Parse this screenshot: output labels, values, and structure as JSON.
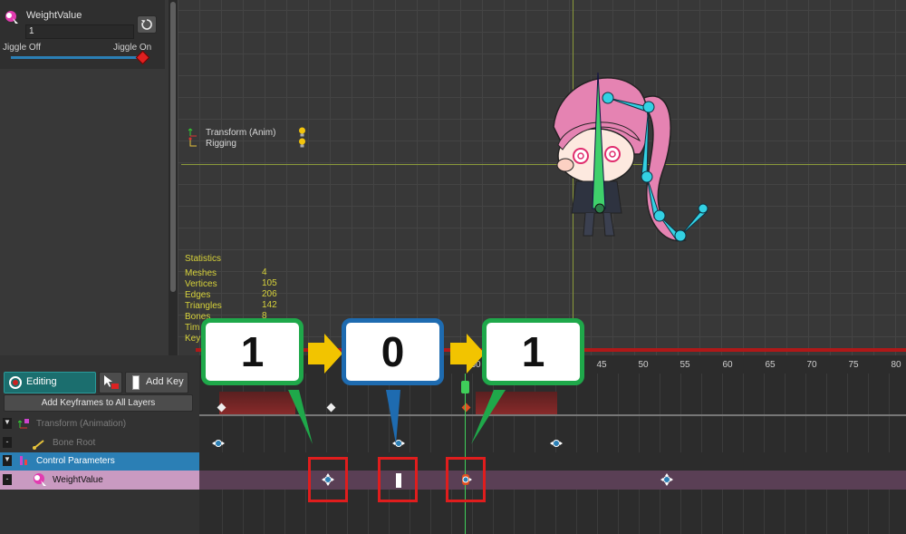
{
  "inspector": {
    "param_name": "WeightValue",
    "param_value": "1",
    "reset_icon": "refresh-icon",
    "slider_min_label": "Jiggle Off",
    "slider_max_label": "Jiggle On",
    "slider_value": 1.0
  },
  "viewport": {
    "layers": [
      {
        "label": "Transform (Anim)",
        "icon": "transform-icon"
      },
      {
        "label": "Rigging",
        "icon": "rigging-icon"
      }
    ],
    "statistics": {
      "title": "Statistics",
      "rows": [
        {
          "label": "Meshes",
          "value": "4"
        },
        {
          "label": "Vertices",
          "value": "105"
        },
        {
          "label": "Edges",
          "value": "206"
        },
        {
          "label": "Triangles",
          "value": "142"
        },
        {
          "label": "Bones",
          "value": "8"
        },
        {
          "label": "Tim",
          "value": ""
        },
        {
          "label": "Key",
          "value": ""
        }
      ]
    }
  },
  "timeline": {
    "editing_label": "Editing",
    "add_key_label": "Add Key",
    "add_all_label": "Add Keyframes to All Layers",
    "tracks": [
      {
        "label": "Transform (Animation)",
        "toggle": "▼",
        "style": "dim"
      },
      {
        "label": "Bone Root",
        "toggle": "-",
        "style": "dim"
      },
      {
        "label": "Control Parameters",
        "toggle": "▼",
        "style": "selected"
      },
      {
        "label": "WeightValue",
        "toggle": "-",
        "style": "pink"
      }
    ],
    "ruler": [
      "30",
      "45",
      "50",
      "55",
      "60",
      "65",
      "70",
      "75",
      "80"
    ]
  },
  "callouts": [
    "1",
    "0",
    "1"
  ],
  "colors": {
    "accent": "#2b7fb5",
    "pink_row": "#c99ac1",
    "callout_green": "#1fa84a",
    "callout_blue": "#1e6bb0",
    "arrow_yellow": "#f2c400",
    "redbox": "#e01d1d"
  }
}
